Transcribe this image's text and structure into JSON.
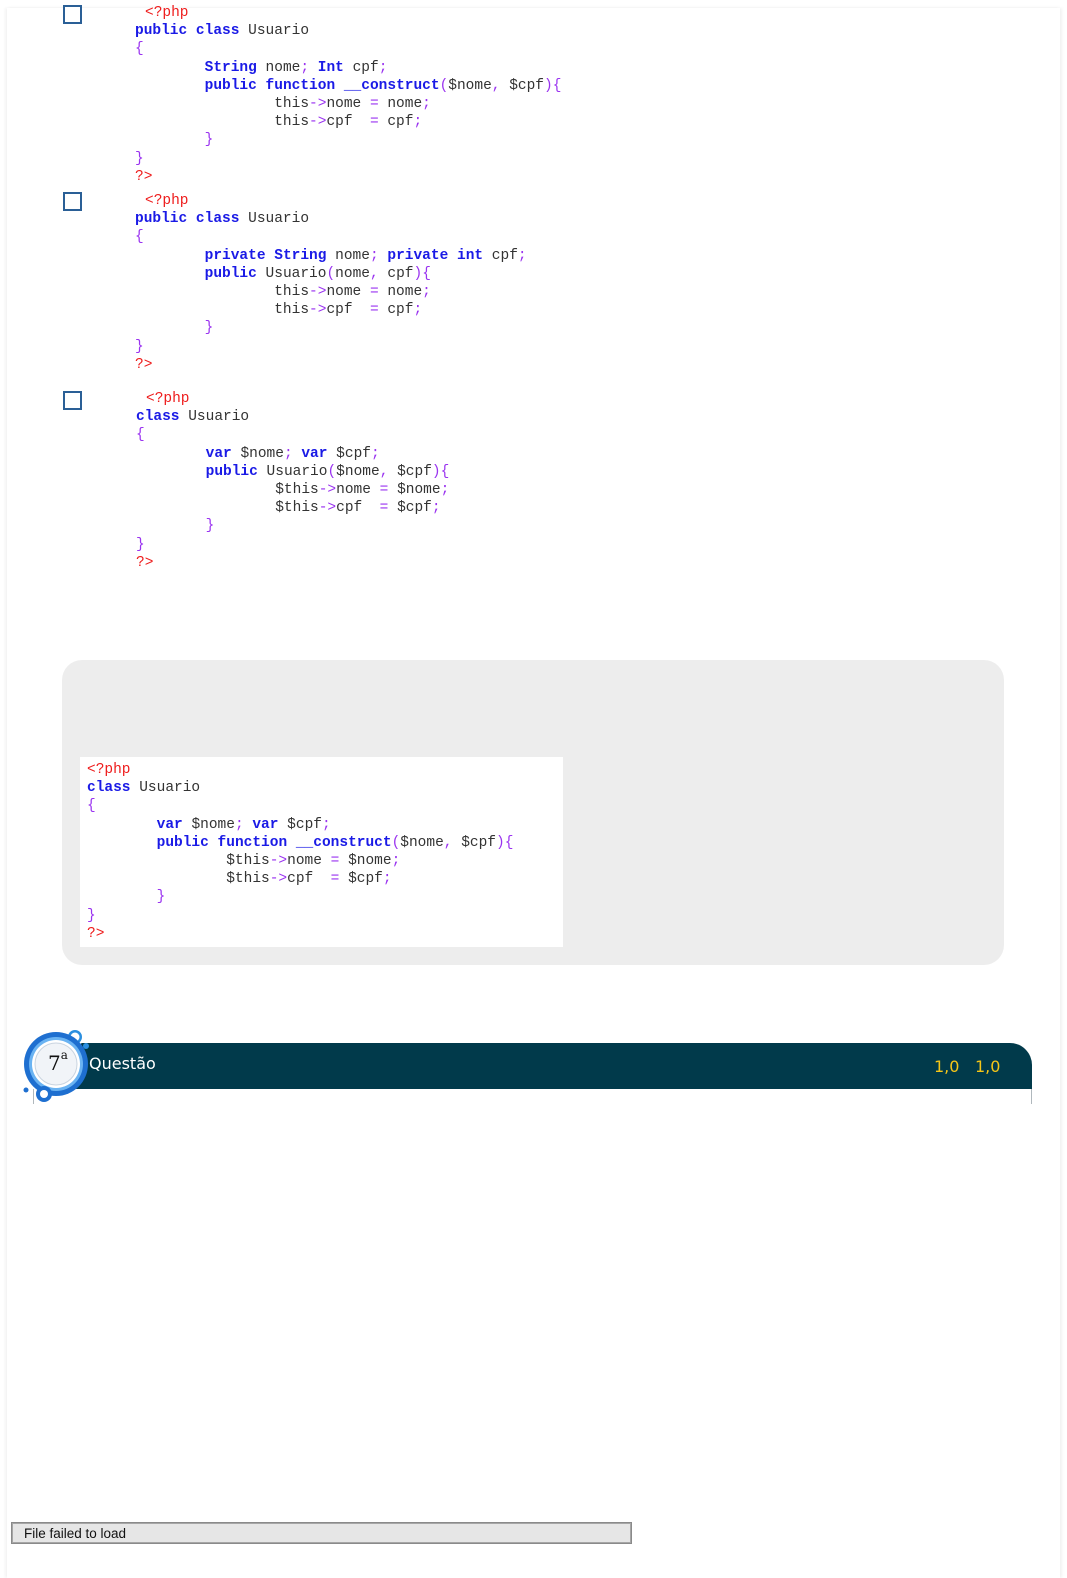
{
  "options": [
    {
      "lines": [
        [
          [
            "r",
            "<?php"
          ]
        ],
        [
          [
            "k",
            "public class "
          ],
          [
            "t",
            "Usuario"
          ]
        ],
        [
          [
            "p",
            "{"
          ]
        ],
        [
          [
            "t",
            "        "
          ],
          [
            "k",
            "String "
          ],
          [
            "t",
            "nome"
          ],
          [
            "p",
            "; "
          ],
          [
            "k",
            "Int "
          ],
          [
            "t",
            "cpf"
          ],
          [
            "p",
            ";"
          ]
        ],
        [
          [
            "t",
            "        "
          ],
          [
            "k",
            "public function "
          ],
          [
            "k",
            "__construct"
          ],
          [
            "p",
            "("
          ],
          [
            "t",
            "$nome"
          ],
          [
            "p",
            ", "
          ],
          [
            "t",
            "$cpf"
          ],
          [
            "p",
            "){"
          ]
        ],
        [
          [
            "t",
            "                this"
          ],
          [
            "p",
            "->"
          ],
          [
            "t",
            "nome "
          ],
          [
            "p",
            "= "
          ],
          [
            "t",
            "nome"
          ],
          [
            "p",
            ";"
          ]
        ],
        [
          [
            "t",
            "                this"
          ],
          [
            "p",
            "->"
          ],
          [
            "t",
            "cpf  "
          ],
          [
            "p",
            "= "
          ],
          [
            "t",
            "cpf"
          ],
          [
            "p",
            ";"
          ]
        ],
        [
          [
            "t",
            "        "
          ],
          [
            "p",
            "}"
          ]
        ],
        [
          [
            "p",
            "}"
          ]
        ],
        [
          [
            "r",
            "?>"
          ]
        ]
      ]
    },
    {
      "lines": [
        [
          [
            "r",
            "<?php"
          ]
        ],
        [
          [
            "k",
            "public class "
          ],
          [
            "t",
            "Usuario"
          ]
        ],
        [
          [
            "p",
            "{"
          ]
        ],
        [
          [
            "t",
            "        "
          ],
          [
            "k",
            "private String "
          ],
          [
            "t",
            "nome"
          ],
          [
            "p",
            "; "
          ],
          [
            "k",
            "private int "
          ],
          [
            "t",
            "cpf"
          ],
          [
            "p",
            ";"
          ]
        ],
        [
          [
            "t",
            "        "
          ],
          [
            "k",
            "public "
          ],
          [
            "t",
            "Usuario"
          ],
          [
            "p",
            "("
          ],
          [
            "t",
            "nome"
          ],
          [
            "p",
            ", "
          ],
          [
            "t",
            "cpf"
          ],
          [
            "p",
            "){"
          ]
        ],
        [
          [
            "t",
            "                this"
          ],
          [
            "p",
            "->"
          ],
          [
            "t",
            "nome "
          ],
          [
            "p",
            "= "
          ],
          [
            "t",
            "nome"
          ],
          [
            "p",
            ";"
          ]
        ],
        [
          [
            "t",
            "                this"
          ],
          [
            "p",
            "->"
          ],
          [
            "t",
            "cpf  "
          ],
          [
            "p",
            "= "
          ],
          [
            "t",
            "cpf"
          ],
          [
            "p",
            ";"
          ]
        ],
        [
          [
            "t",
            "        "
          ],
          [
            "p",
            "}"
          ]
        ],
        [
          [
            "p",
            "}"
          ]
        ],
        [
          [
            "r",
            "?>"
          ]
        ]
      ]
    },
    {
      "lines": [
        [
          [
            "r",
            "<?php"
          ]
        ],
        [
          [
            "k",
            "class "
          ],
          [
            "t",
            "Usuario"
          ]
        ],
        [
          [
            "p",
            "{"
          ]
        ],
        [
          [
            "t",
            "        "
          ],
          [
            "k",
            "var "
          ],
          [
            "t",
            "$nome"
          ],
          [
            "p",
            "; "
          ],
          [
            "k",
            "var "
          ],
          [
            "t",
            "$cpf"
          ],
          [
            "p",
            ";"
          ]
        ],
        [
          [
            "t",
            "        "
          ],
          [
            "k",
            "public "
          ],
          [
            "t",
            "Usuario"
          ],
          [
            "p",
            "("
          ],
          [
            "t",
            "$nome"
          ],
          [
            "p",
            ", "
          ],
          [
            "t",
            "$cpf"
          ],
          [
            "p",
            "){"
          ]
        ],
        [
          [
            "t",
            "                $this"
          ],
          [
            "p",
            "->"
          ],
          [
            "t",
            "nome "
          ],
          [
            "p",
            "= "
          ],
          [
            "t",
            "$nome"
          ],
          [
            "p",
            ";"
          ]
        ],
        [
          [
            "t",
            "                $this"
          ],
          [
            "p",
            "->"
          ],
          [
            "t",
            "cpf  "
          ],
          [
            "p",
            "= "
          ],
          [
            "t",
            "$cpf"
          ],
          [
            "p",
            ";"
          ]
        ],
        [
          [
            "t",
            "        "
          ],
          [
            "p",
            "}"
          ]
        ],
        [
          [
            "p",
            "}"
          ]
        ],
        [
          [
            "r",
            "?>"
          ]
        ]
      ]
    }
  ],
  "answer": {
    "lines": [
      [
        [
          "r",
          "<?php"
        ]
      ],
      [
        [
          "k",
          "class "
        ],
        [
          "t",
          "Usuario"
        ]
      ],
      [
        [
          "p",
          "{"
        ]
      ],
      [
        [
          "t",
          "        "
        ],
        [
          "k",
          "var "
        ],
        [
          "t",
          "$nome"
        ],
        [
          "p",
          "; "
        ],
        [
          "k",
          "var "
        ],
        [
          "t",
          "$cpf"
        ],
        [
          "p",
          ";"
        ]
      ],
      [
        [
          "t",
          "        "
        ],
        [
          "k",
          "public function "
        ],
        [
          "k",
          "__construct"
        ],
        [
          "p",
          "("
        ],
        [
          "t",
          "$nome"
        ],
        [
          "p",
          ", "
        ],
        [
          "t",
          "$cpf"
        ],
        [
          "p",
          "){"
        ]
      ],
      [
        [
          "t",
          "                $this"
        ],
        [
          "p",
          "->"
        ],
        [
          "t",
          "nome "
        ],
        [
          "p",
          "= "
        ],
        [
          "t",
          "$nome"
        ],
        [
          "p",
          ";"
        ]
      ],
      [
        [
          "t",
          "                $this"
        ],
        [
          "p",
          "->"
        ],
        [
          "t",
          "cpf  "
        ],
        [
          "p",
          "= "
        ],
        [
          "t",
          "$cpf"
        ],
        [
          "p",
          ";"
        ]
      ],
      [
        [
          "t",
          "        "
        ],
        [
          "p",
          "}"
        ]
      ],
      [
        [
          "p",
          "}"
        ]
      ],
      [
        [
          "r",
          "?>"
        ]
      ]
    ]
  },
  "question": {
    "number": "7",
    "ordinal_suffix": "a",
    "title": "Questão",
    "score_earned": "1,0",
    "score_total": "1,0"
  },
  "file_status": "File failed to load",
  "colors": {
    "header_bg": "#013a4b",
    "score": "#f5c518",
    "php_tag": "#ee1c1c",
    "keyword": "#1a1ae6",
    "punctuation": "#9a33f0",
    "checkbox_border": "#2a5f96",
    "answer_bg": "#ededed"
  }
}
